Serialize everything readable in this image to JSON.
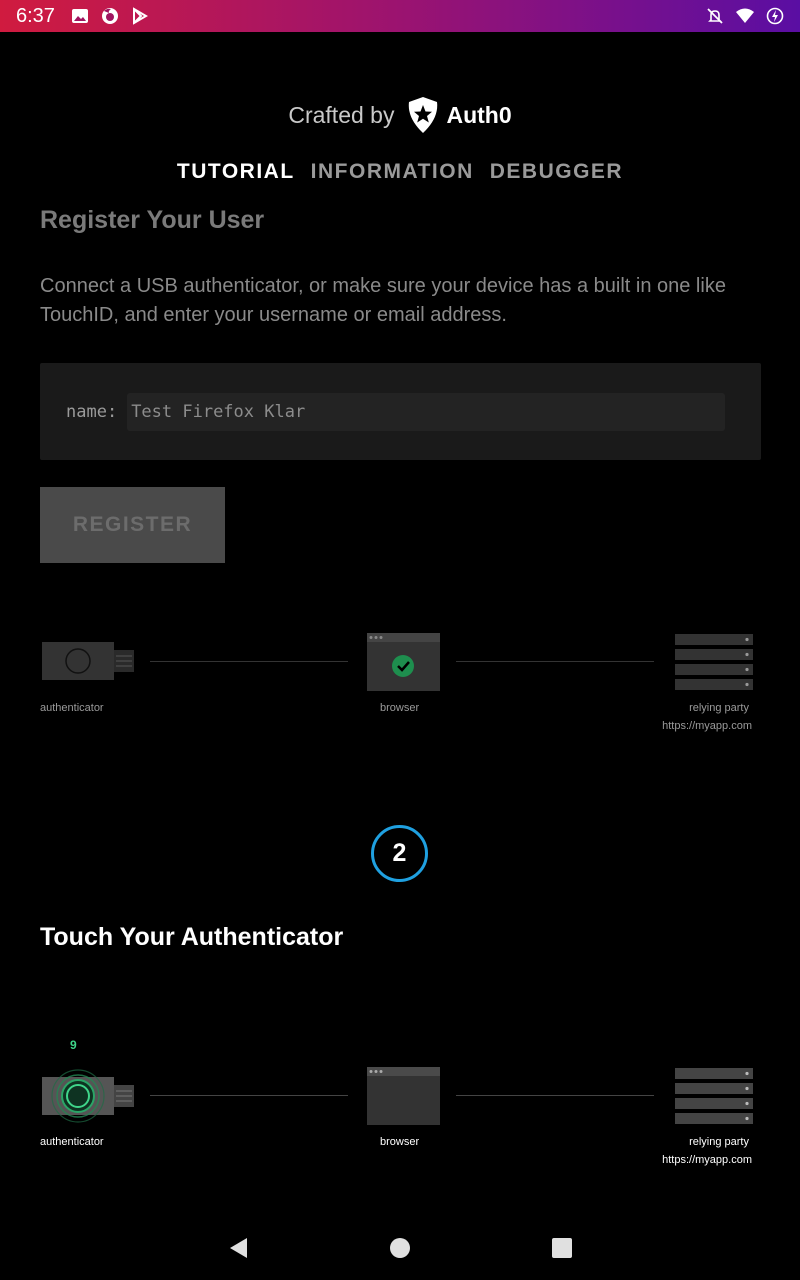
{
  "status_bar": {
    "time": "6:37",
    "left_icons": [
      "image-icon",
      "firefox-icon",
      "play-store-icon"
    ],
    "right_icons": [
      "notifications-off-icon",
      "wifi-icon",
      "battery-charging-icon"
    ]
  },
  "header": {
    "crafted_by": "Crafted by",
    "brand": "Auth0"
  },
  "tabs": [
    {
      "label": "TUTORIAL",
      "active": true
    },
    {
      "label": "INFORMATION",
      "active": false
    },
    {
      "label": "DEBUGGER",
      "active": false
    }
  ],
  "register_section": {
    "title": "Register Your User",
    "description": "Connect a USB authenticator, or make sure your device has a built in one like TouchID, and enter your username or email address.",
    "name_label": "name:",
    "name_value": "Test Firefox Klar",
    "register_button": "REGISTER"
  },
  "flow_1": {
    "authenticator": "authenticator",
    "browser": "browser",
    "relying_party": "relying party",
    "relying_party_url": "https://myapp.com"
  },
  "step_number": "2",
  "touch_section": {
    "title": "Touch Your Authenticator",
    "counter": "9"
  },
  "flow_2": {
    "authenticator": "authenticator",
    "browser": "browser",
    "relying_party": "relying party",
    "relying_party_url": "https://myapp.com"
  },
  "colors": {
    "accent_blue": "#1fa0e0",
    "accent_green": "#3fd58a",
    "check_green": "#1e8e4e"
  }
}
